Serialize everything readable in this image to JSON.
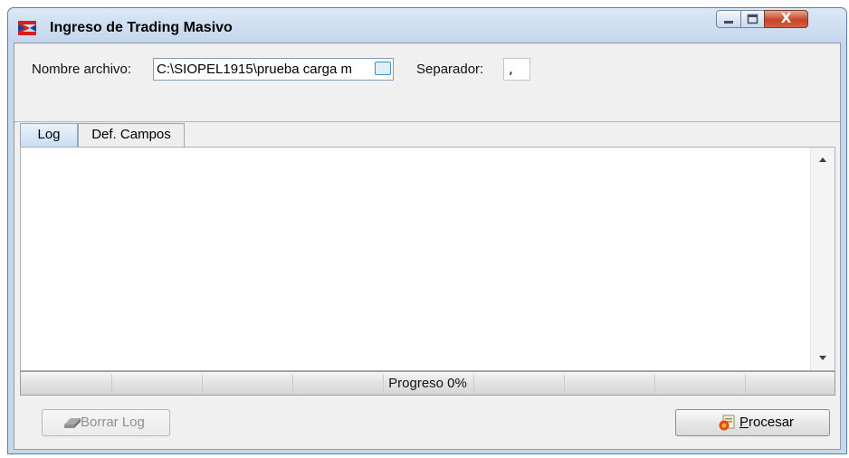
{
  "window": {
    "title": "Ingreso de Trading Masivo",
    "close_glyph": "X"
  },
  "form": {
    "file_label": "Nombre archivo:",
    "file_value": "C:\\SIOPEL1915\\prueba carga m",
    "separator_label": "Separador:",
    "separator_value": ","
  },
  "tabs": [
    {
      "label": "Log",
      "active": true
    },
    {
      "label": "Def. Campos",
      "active": false
    }
  ],
  "log": {
    "content": ""
  },
  "progress": {
    "label": "Progreso 0%",
    "value": 0
  },
  "buttons": {
    "borrar_log": {
      "label": "Borrar Log",
      "enabled": false,
      "icon": "eraser-icon"
    },
    "procesar": {
      "mnemonic": "P",
      "rest": "rocesar",
      "enabled": true,
      "icon": "process-icon"
    }
  },
  "colors": {
    "titlebar": "#c4d6ec",
    "panel": "#f0f0f0",
    "close_button": "#c7432a",
    "progress_fill": "#3a9bdc"
  }
}
